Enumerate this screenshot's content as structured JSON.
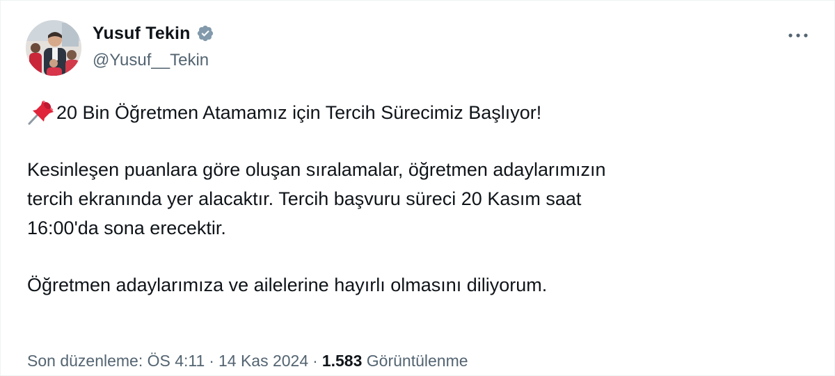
{
  "author": {
    "name": "Yusuf Tekin",
    "handle": "@Yusuf__Tekin",
    "verified": true,
    "avatar_icon": "profile-photo"
  },
  "tweet": {
    "pin_icon": "pushpin-emoji",
    "headline": "20 Bin Öğretmen Atamamız için Tercih Sürecimiz Başlıyor!",
    "paragraph_1_lines": [
      "Kesinleşen puanlara göre oluşan sıralamalar, öğretmen adaylarımızın",
      "tercih ekranında yer alacaktır. Tercih başvuru süreci 20 Kasım saat",
      "16:00'da sona erecektir."
    ],
    "paragraph_2": "Öğretmen adaylarımıza ve ailelerine hayırlı olmasını diliyorum."
  },
  "meta": {
    "edited_label": "Son düzenleme: ÖS 4:11",
    "separator": "·",
    "date": "14 Kas 2024",
    "views_count": "1.583",
    "views_label": "Görüntülenme"
  },
  "colors": {
    "text_primary": "#0f1419",
    "text_secondary": "#536471",
    "verified_badge": "#829aab",
    "pin_red": "#e0243a"
  }
}
